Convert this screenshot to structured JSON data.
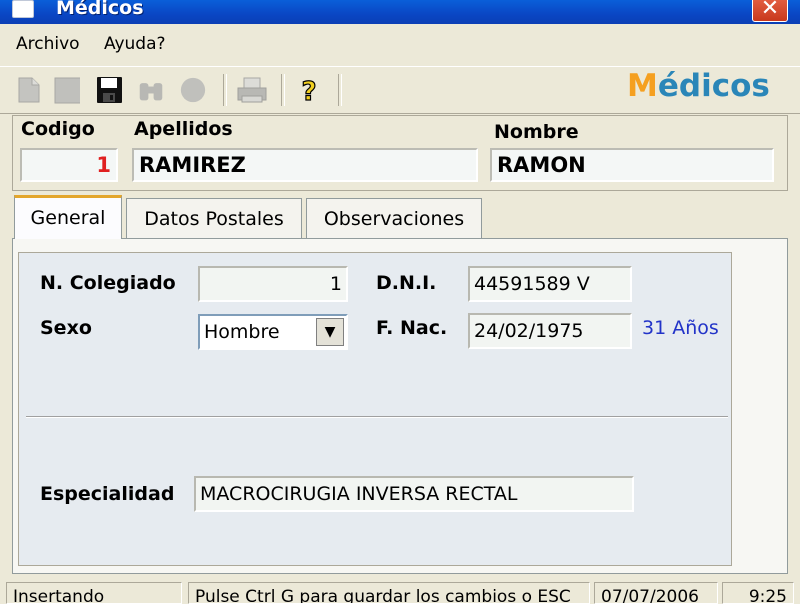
{
  "window": {
    "title": "Médicos",
    "close_label": "✕"
  },
  "menu": {
    "items": [
      "Archivo",
      "Ayuda?"
    ]
  },
  "toolbar": {
    "buttons": [
      "new-doc-icon",
      "stop-icon",
      "save-icon",
      "binoculars-icon",
      "circle-icon",
      "print-icon",
      "help-icon"
    ],
    "help_glyph": "?",
    "brand_first": "M",
    "brand_rest": "édicos"
  },
  "header": {
    "codigo_label": "Codigo",
    "codigo_value": "1",
    "apellidos_label": "Apellidos",
    "apellidos_value": "RAMIREZ",
    "nombre_label": "Nombre",
    "nombre_value": "RAMON"
  },
  "tabs": [
    {
      "label": "General",
      "active": true
    },
    {
      "label": "Datos Postales",
      "active": false
    },
    {
      "label": "Observaciones",
      "active": false
    }
  ],
  "general": {
    "colegiado_label": "N. Colegiado",
    "colegiado_value": "1",
    "dni_label": "D.N.I.",
    "dni_value": "44591589 V",
    "sexo_label": "Sexo",
    "sexo_value": "Hombre",
    "fnac_label": "F. Nac.",
    "fnac_value": "24/02/1975",
    "age_text": "31 Años",
    "especialidad_label": "Especialidad",
    "especialidad_value": "MACROCIRUGIA INVERSA RECTAL"
  },
  "status": {
    "mode": "Insertando",
    "hint": "Pulse Ctrl G para guardar los cambios o ESC",
    "date": "07/07/2006",
    "time": "9:25"
  },
  "colors": {
    "titlebar": "#0a46c4",
    "codigo_value": "#e02020",
    "brand_accent": "#f5a020",
    "brand_main": "#2a86b8",
    "age_text": "#2233c8",
    "tab_highlight": "#e3a62c"
  }
}
